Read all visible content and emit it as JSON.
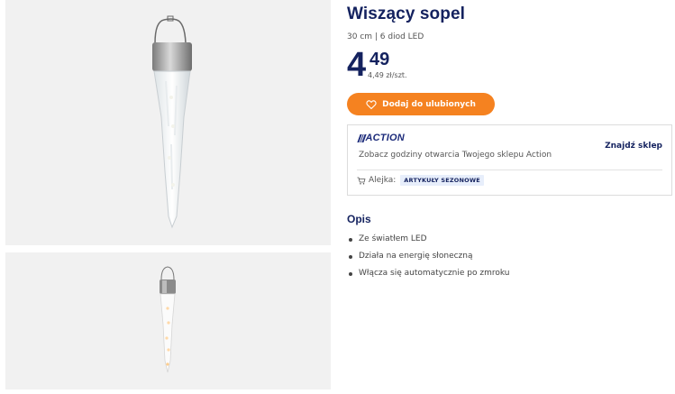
{
  "product": {
    "title": "Wiszący sopel",
    "subtitle": "30 cm | 6 diod LED",
    "price_int": "4",
    "price_dec": "49",
    "unit_price": "4,49 zł/szt."
  },
  "favorite_button": {
    "label": "Dodaj do ulubionych",
    "icon": "heart-icon"
  },
  "store": {
    "brand": "ACTION",
    "text": "Zobacz godziny otwarcia Twojego sklepu Action",
    "link": "Znajdź sklep",
    "aisle_label": "Alejka:",
    "aisle_value": "ARTYKUŁY SEZONOWE",
    "aisle_icon": "cart-icon"
  },
  "description": {
    "title": "Opis",
    "items": [
      "Ze światłem LED",
      "Działa na energię słoneczną",
      "Włącza się automatycznie po zmroku"
    ]
  },
  "colors": {
    "accent": "#f58220",
    "brand": "#14225f"
  }
}
